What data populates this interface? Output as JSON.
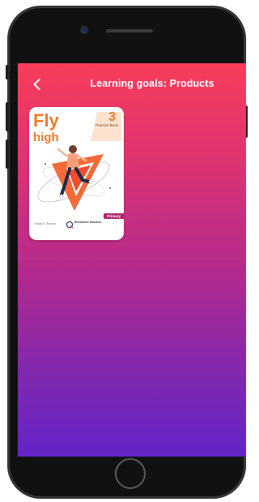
{
  "header": {
    "back_icon": "chevron-left-icon",
    "title": "Learning goals: Products"
  },
  "product": {
    "cover_title_line1": "Fly",
    "cover_title_line2": "high",
    "level": "3",
    "book_type": "Practice Book",
    "author": "Giulia G. Boneo",
    "publisher": "Richmond Solution",
    "tag": "Primary"
  },
  "colors": {
    "gradient_top": "#f93d5a",
    "gradient_bottom": "#6424c8",
    "cover_accent": "#f07a2b",
    "tag": "#b0266e"
  }
}
